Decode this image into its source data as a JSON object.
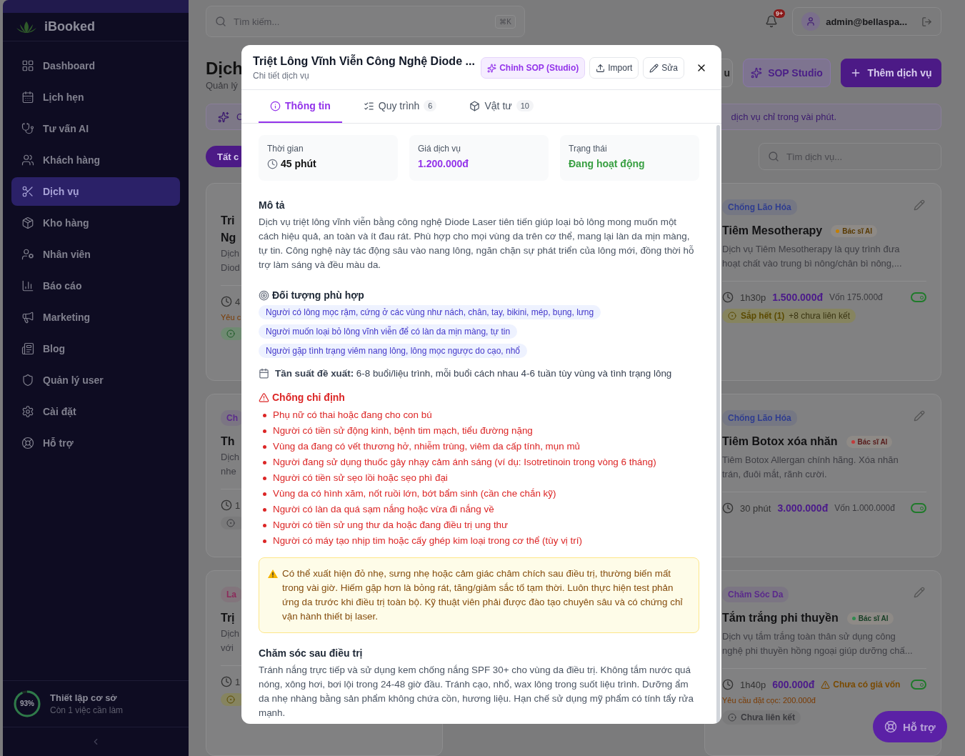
{
  "sidebar": {
    "brand": "iBooked",
    "items": [
      {
        "label": "Dashboard",
        "kind": "dashboard",
        "selected": false
      },
      {
        "label": "Lịch hẹn",
        "kind": "calendar",
        "selected": false
      },
      {
        "label": "Tư vấn AI",
        "kind": "stethoscope",
        "selected": false
      },
      {
        "label": "Khách hàng",
        "kind": "users",
        "selected": false
      },
      {
        "label": "Dịch vụ",
        "kind": "scissors",
        "selected": true
      },
      {
        "label": "Kho hàng",
        "kind": "package",
        "selected": false
      },
      {
        "label": "Nhân viên",
        "kind": "staff",
        "selected": false
      },
      {
        "label": "Báo cáo",
        "kind": "chart",
        "selected": false
      },
      {
        "label": "Marketing",
        "kind": "megaphone",
        "selected": false
      },
      {
        "label": "Blog",
        "kind": "news",
        "selected": false
      },
      {
        "label": "Quản lý user",
        "kind": "shield",
        "selected": false
      },
      {
        "label": "Cài đặt",
        "kind": "settings",
        "selected": false
      },
      {
        "label": "Hỗ trợ",
        "kind": "help",
        "selected": false
      }
    ],
    "setup": {
      "percent": "93%",
      "level": 0.93,
      "title": "Thiết lập cơ sở",
      "subtitle": "Còn 1 việc cần làm"
    }
  },
  "topbar": {
    "search": {
      "placeholder": "Tìm kiếm...",
      "shortcut": "⌘K"
    },
    "notifications": "9+",
    "user": "admin@bellaspa..."
  },
  "header": {
    "title": "Dịch",
    "subtitle": "Quản lý",
    "buttons": [
      {
        "label": "u",
        "kind": "outline"
      },
      {
        "label": "SOP Studio",
        "kind": "soft"
      },
      {
        "label": "Thêm dịch vụ",
        "kind": "primary"
      }
    ]
  },
  "banner": {
    "left": "C",
    "right": "dịch vụ chỉ trong vài phút."
  },
  "filters": {
    "active_chip": "Tất c",
    "search_placeholder": "Tìm dịch vụ..."
  },
  "cards_left": [
    {
      "title_lines": [
        "Tri",
        "Ng"
      ],
      "desc_lines": [
        "Dịch",
        "Diod"
      ],
      "duration": "4",
      "note": "Yêu c",
      "chip": {
        "kind": "linked"
      }
    },
    {
      "tag": {
        "label": "Ch",
        "color": "#5b2a8c"
      },
      "title_lines": [
        "Th"
      ],
      "desc_lines": [
        "Dịch",
        "nhe"
      ],
      "duration": "1",
      "chip": {
        "kind": "none"
      }
    },
    {
      "tag": {
        "label": "La",
        "color": "#8c2a5a"
      },
      "title_lines": [
        "Trị"
      ],
      "desc_lines": [
        "Dịch",
        "với"
      ],
      "duration": "1",
      "chip": {
        "kind": "low"
      }
    }
  ],
  "cards_right": [
    {
      "tag": {
        "label": "Chống Lão Hóa",
        "color": "#2f3d8f"
      },
      "title": "Tiêm Mesotherapy",
      "ai_badge": {
        "label": "Bác sĩ AI",
        "color": "#c47f00"
      },
      "desc_lines": [
        "Dịch vụ Tiêm Mesotherapy là quy trình đưa",
        "hoạt chất vào trung bì nông/chân bì nông,..."
      ],
      "duration": "1h30p",
      "price": "1.500.000đ",
      "cost": {
        "kind": "cost",
        "label": "Vốn 175.000đ"
      },
      "active": true,
      "chip": {
        "kind": "low",
        "label": "Sắp hết (1)",
        "extra": "+8 chưa liên kết"
      }
    },
    {
      "tag": {
        "label": "Chống Lão Hóa",
        "color": "#2f3d8f"
      },
      "title": "Tiêm Botox xóa nhăn",
      "ai_badge": {
        "label": "Bác sĩ AI",
        "color": "#c23b3b"
      },
      "desc_lines": [
        "Tiêm Botox Allergan chính hãng. Xóa nhăn",
        "trán, đuôi mắt, rãnh cười."
      ],
      "duration": "30 phút",
      "price": "3.000.000đ",
      "cost": {
        "kind": "cost",
        "label": "Vốn 1.000.000đ"
      },
      "active": true
    },
    {
      "tag": {
        "label": "Chăm Sóc Da",
        "color": "#5b2a8c"
      },
      "title": "Tắm trắng phi thuyền",
      "ai_badge": {
        "label": "Bác sĩ AI",
        "color": "#2f8a4f"
      },
      "desc_lines": [
        "Dịch vụ tắm trắng toàn thân sử dụng công",
        "nghệ phi thuyền hồng ngoại giúp dưỡng chấ..."
      ],
      "duration": "1h40p",
      "price": "600.000đ",
      "cost": {
        "kind": "missing",
        "label": "Chưa có giá vốn"
      },
      "active": true,
      "deposit": "Yêu cầu đặt cọc: 200.000đ",
      "chip": {
        "kind": "none",
        "label": "Chưa liên kết"
      }
    }
  ],
  "modal": {
    "title": "Triệt Lông Vĩnh Viễn Công Nghệ Diode ...",
    "subtitle": "Chi tiết dịch vụ",
    "actions": [
      {
        "label": "Chỉnh SOP (Studio)",
        "kind": "studio"
      },
      {
        "label": "Import",
        "kind": "import"
      },
      {
        "label": "Sửa",
        "kind": "edit"
      }
    ],
    "tabs": [
      {
        "label": "Thông tin",
        "kind": "info",
        "selected": true
      },
      {
        "label": "Quy trình",
        "kind": "steps",
        "count": "6",
        "selected": false
      },
      {
        "label": "Vật tư",
        "kind": "materials",
        "count": "10",
        "selected": false
      }
    ],
    "stats": [
      {
        "label": "Thời gian",
        "value": "45 phút",
        "kind": "duration"
      },
      {
        "label": "Giá dịch vụ",
        "value": "1.200.000đ",
        "kind": "price"
      },
      {
        "label": "Trạng thái",
        "value": "Đang hoạt động",
        "kind": "status"
      }
    ],
    "description": {
      "heading": "Mô tả",
      "text": "Dịch vụ triệt lông vĩnh viễn bằng công nghệ Diode Laser tiên tiến giúp loại bỏ lông mong muốn một cách hiệu quả, an toàn và ít đau rát. Phù hợp cho mọi vùng da trên cơ thể, mang lại làn da mịn màng, tự tin. Công nghệ này tác động sâu vào nang lông, ngăn chặn sự phát triển của lông mới, đồng thời hỗ trợ làm sáng và đều màu da."
    },
    "audience": {
      "heading": "Đối tượng phù hợp",
      "tags": [
        "Người có lông mọc rậm, cứng ở các vùng như nách, chân, tay, bikini, mép, bụng, lưng",
        "Người muốn loại bỏ lông vĩnh viễn để có làn da mịn màng, tự tin",
        "Người gặp tình trạng viêm nang lông, lông mọc ngược do cạo, nhổ"
      ]
    },
    "frequency": "**Tần suất đề xuất:** 6-8 buổi/liệu trình, mỗi buổi cách nhau 4-6 tuần tùy vùng và tình trạng lông",
    "contraindications": {
      "heading": "Chống chỉ định",
      "items": [
        "Phụ nữ có thai hoặc đang cho con bú",
        "Người có tiền sử động kinh, bệnh tim mạch, tiểu đường nặng",
        "Vùng da đang có vết thương hở, nhiễm trùng, viêm da cấp tính, mụn mủ",
        "Người đang sử dụng thuốc gây nhạy cảm ánh sáng (ví dụ: Isotretinoin trong vòng 6 tháng)",
        "Người có tiền sử sẹo lồi hoặc sẹo phì đại",
        "Vùng da có hình xăm, nốt ruồi lớn, bớt bẩm sinh (cần che chắn kỹ)",
        "Người có làn da quá sạm nắng hoặc vừa đi nắng về",
        "Người có tiền sử ung thư da hoặc đang điều trị ung thư",
        "Người có máy tạo nhịp tim hoặc cấy ghép kim loại trong cơ thể (tùy vị trí)"
      ]
    },
    "warning": "Có thể xuất hiện đỏ nhẹ, sưng nhẹ hoặc cảm giác châm chích sau điều trị, thường biến mất trong vài giờ. Hiếm gặp hơn là bỏng rát, tăng/giảm sắc tố tạm thời. Luôn thực hiện test phản ứng da trước khi điều trị toàn bộ. Kỹ thuật viên phải được đào tạo chuyên sâu và có chứng chỉ vận hành thiết bị laser.",
    "aftercare": {
      "heading": "Chăm sóc sau điều trị",
      "text": "Tránh nắng trực tiếp và sử dụng kem chống nắng SPF 30+ cho vùng da điều trị. Không tắm nước quá nóng, xông hơi, bơi lội trong 24-48 giờ đầu. Tránh cạo, nhổ, wax lông trong suốt liệu trình. Dưỡng ẩm da nhẹ nhàng bằng sản phẩm không chứa cồn, hương liệu. Hạn chế sử dụng mỹ phẩm có tính tẩy rửa mạnh."
    }
  },
  "support_button": "Hỗ trợ"
}
